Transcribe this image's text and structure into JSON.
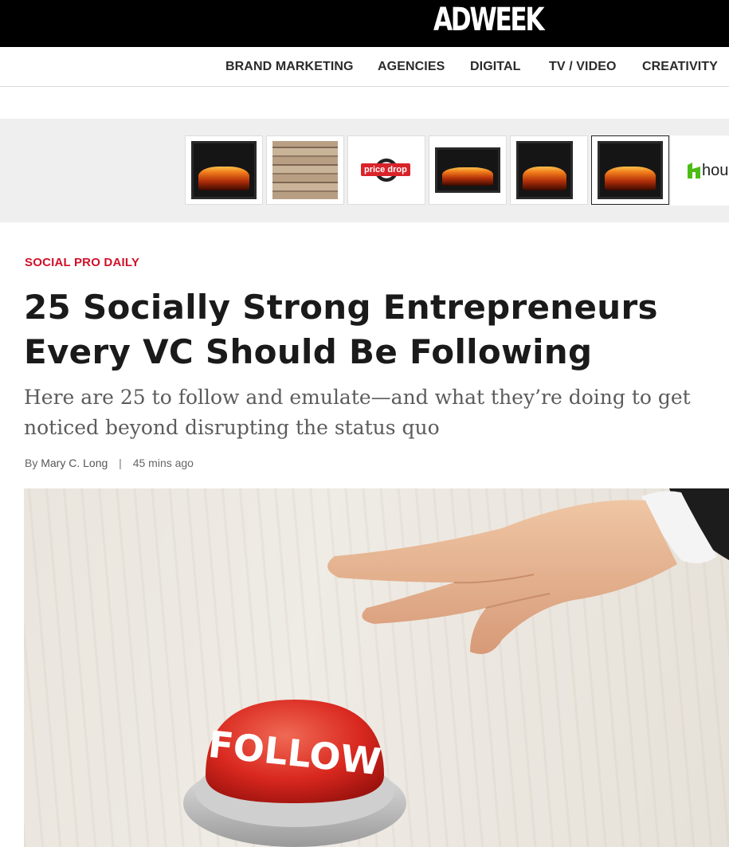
{
  "header": {
    "logo_text": "ADWEEK"
  },
  "nav": {
    "items": [
      {
        "label": "BRAND MARKETING"
      },
      {
        "label": "AGENCIES"
      },
      {
        "label": "DIGITAL"
      },
      {
        "label": "TV / VIDEO"
      },
      {
        "label": "CREATIVITY"
      }
    ]
  },
  "ad": {
    "thumbnails": [
      {
        "icon": "fireplace-image"
      },
      {
        "icon": "stone-panel-image"
      },
      {
        "icon": "tile-image",
        "badge": "price drop"
      },
      {
        "icon": "fireplace-insert-image"
      },
      {
        "icon": "curved-fireplace-image"
      },
      {
        "icon": "fireplace-image",
        "selected": true
      }
    ],
    "brand_text": "hou",
    "brand_color": "#4dbc15"
  },
  "article": {
    "kicker": "SOCIAL PRO DAILY",
    "kicker_color": "#d1102a",
    "headline": "25 Socially Strong Entrepreneurs Every VC Should Be Following",
    "dek": "Here are 25 to follow and emulate—and what they’re doing to get noticed beyond disrupting the status quo",
    "byline_prefix": "By",
    "author": "Mary C. Long",
    "separator": "|",
    "timestamp": "45 mins ago"
  },
  "hero": {
    "button_text": "FOLLOW",
    "button_color": "#d9281f"
  }
}
